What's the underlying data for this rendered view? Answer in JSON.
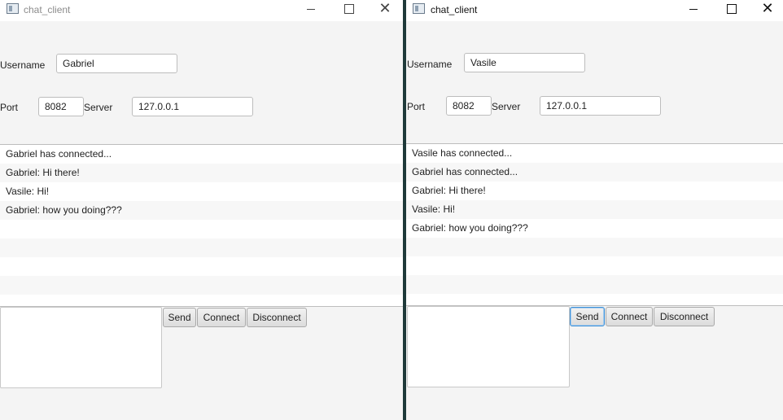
{
  "windows": [
    {
      "title": "chat_client",
      "username_label": "Username",
      "username_value": "Gabriel",
      "port_label": "Port",
      "port_value": "8082",
      "server_label": "Server",
      "server_value": "127.0.0.1",
      "messages": [
        "Gabriel has connected...",
        "Gabriel: Hi there!",
        "Vasile: Hi!",
        "Gabriel: how you doing???",
        "",
        "",
        "",
        ""
      ],
      "send_label": "Send",
      "connect_label": "Connect",
      "disconnect_label": "Disconnect"
    },
    {
      "title": "chat_client",
      "username_label": "Username",
      "username_value": "Vasile",
      "port_label": "Port",
      "port_value": "8082",
      "server_label": "Server",
      "server_value": "127.0.0.1",
      "messages": [
        "Vasile has connected...",
        "Gabriel has connected...",
        "Gabriel: Hi there!",
        "Vasile: Hi!",
        "Gabriel: how you doing???",
        "",
        "",
        "",
        ""
      ],
      "send_label": "Send",
      "connect_label": "Connect",
      "disconnect_label": "Disconnect"
    }
  ],
  "titlebar_buttons": {
    "minimize": "minimize-icon",
    "maximize": "maximize-icon",
    "close": "close-icon",
    "close_glyph": "✕"
  },
  "colors": {
    "window_bg": "#f4f4f4",
    "focus_accent": "#3c8fd6",
    "divider": "#1f3a3a"
  }
}
